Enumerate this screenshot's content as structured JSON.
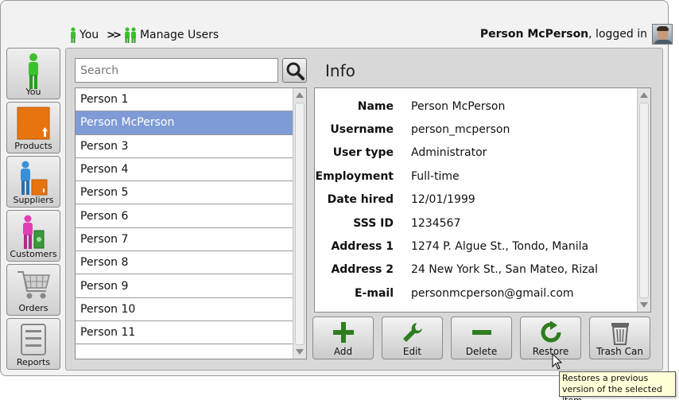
{
  "breadcrumb": {
    "items": [
      "You",
      "Manage Users"
    ],
    "separator": ">>"
  },
  "session": {
    "user_name": "Person McPerson",
    "suffix": ", logged in"
  },
  "sidebar": {
    "items": [
      {
        "label": "You",
        "icon": "person-green-icon"
      },
      {
        "label": "Products",
        "icon": "box-orange-icon"
      },
      {
        "label": "Suppliers",
        "icon": "supplier-icon"
      },
      {
        "label": "Customers",
        "icon": "customer-icon"
      },
      {
        "label": "Orders",
        "icon": "cart-icon"
      },
      {
        "label": "Reports",
        "icon": "report-icon"
      }
    ]
  },
  "search": {
    "placeholder": "Search",
    "value": ""
  },
  "user_list": {
    "items": [
      "Person 1",
      "Person McPerson",
      "Person 3",
      "Person 4",
      "Person 5",
      "Person 6",
      "Person 7",
      "Person 8",
      "Person 9",
      "Person 10",
      "Person 11"
    ],
    "selected": "Person McPerson"
  },
  "info": {
    "title": "Info",
    "fields": [
      {
        "label": "Name",
        "value": "Person McPerson"
      },
      {
        "label": "Username",
        "value": "person_mcperson"
      },
      {
        "label": "User type",
        "value": "Administrator"
      },
      {
        "label": "Employment",
        "value": "Full-time"
      },
      {
        "label": "Date hired",
        "value": "12/01/1999"
      },
      {
        "label": "SSS ID",
        "value": "1234567"
      },
      {
        "label": "Address 1",
        "value": "1274 P. Algue St., Tondo, Manila"
      },
      {
        "label": "Address 2",
        "value": "24 New York St., San Mateo, Rizal"
      },
      {
        "label": "E-mail",
        "value": "personmcperson@gmail.com"
      }
    ]
  },
  "actions": {
    "add": "Add",
    "edit": "Edit",
    "delete": "Delete",
    "restore": "Restore",
    "trash": "Trash Can"
  },
  "tooltip": {
    "text": "Restores a previous version of the selected item"
  },
  "colors": {
    "selected_row": "#7f9bd6",
    "action_green": "#2e7d1e",
    "tooltip_bg": "#ffffd8"
  }
}
